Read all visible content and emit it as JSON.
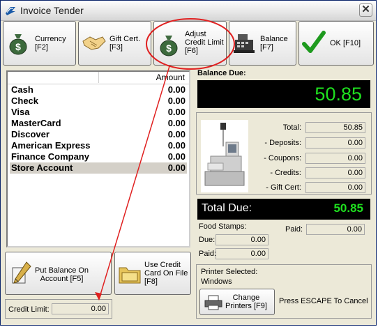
{
  "window": {
    "title": "Invoice Tender",
    "close_glyph": "✕"
  },
  "toolbar": [
    {
      "label": "Currency\n[F2]",
      "icon": "money-bag-icon"
    },
    {
      "label": "Gift Cert.\n[F3]",
      "icon": "handshake-icon"
    },
    {
      "label": "Adjust\nCredit Limit\n[F6]",
      "icon": "money-bag-icon"
    },
    {
      "label": "Balance\n[F7]",
      "icon": "cash-register-icon"
    },
    {
      "label": "OK [F10]",
      "icon": "checkmark-icon"
    }
  ],
  "payments": {
    "header_amount": "Amount",
    "rows": [
      {
        "name": "Cash",
        "amount": "0.00"
      },
      {
        "name": "Check",
        "amount": "0.00"
      },
      {
        "name": "Visa",
        "amount": "0.00"
      },
      {
        "name": "MasterCard",
        "amount": "0.00"
      },
      {
        "name": "Discover",
        "amount": "0.00"
      },
      {
        "name": "American Express",
        "amount": "0.00"
      },
      {
        "name": "Finance Company",
        "amount": "0.00"
      },
      {
        "name": "Store Account",
        "amount": "0.00"
      }
    ]
  },
  "balance": {
    "label": "Balance Due:",
    "value": "50.85"
  },
  "summary": {
    "total_label": "Total:",
    "total": "50.85",
    "deposits_label": "- Deposits:",
    "deposits": "0.00",
    "coupons_label": "- Coupons:",
    "coupons": "0.00",
    "credits_label": "- Credits:",
    "credits": "0.00",
    "giftcert_label": "- Gift Cert:",
    "giftcert": "0.00"
  },
  "total_due": {
    "label": "Total Due:",
    "value": "50.85"
  },
  "food_stamps": {
    "label": "Food Stamps:",
    "due_label": "Due:",
    "due": "0.00",
    "paid_label": "Paid:",
    "paid": "0.00"
  },
  "paid": {
    "label": "Paid:",
    "value": "0.00"
  },
  "bottom": {
    "put_balance_label": "Put Balance On\nAccount [F5]",
    "use_credit_label": "Use Credit\nCard On File\n[F8]",
    "credit_limit_label": "Credit Limit:",
    "credit_limit_value": "0.00",
    "printer_selected_label": "Printer Selected:",
    "printer_name": "Windows",
    "change_printers_label": "Change\nPrinters [F9]",
    "escape_hint": "Press ESCAPE To Cancel"
  },
  "colors": {
    "annotation": "#e02020",
    "lcd_text": "#1fe01f"
  }
}
